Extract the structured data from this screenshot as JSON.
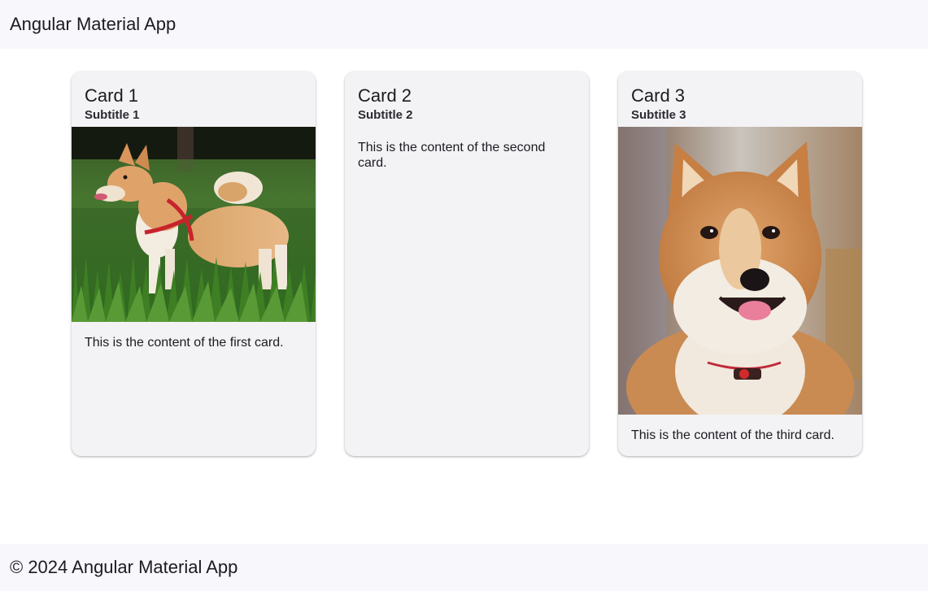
{
  "toolbar": {
    "title": "Angular Material App"
  },
  "cards": [
    {
      "title": "Card 1",
      "subtitle": "Subtitle 1",
      "content": "This is the content of the first card.",
      "image": "shiba-inu-standing-in-grass-photo"
    },
    {
      "title": "Card 2",
      "subtitle": "Subtitle 2",
      "content": "This is the content of the second card."
    },
    {
      "title": "Card 3",
      "subtitle": "Subtitle 3",
      "content": "This is the content of the third card.",
      "image": "shiba-inu-portrait-photo"
    }
  ],
  "footer": {
    "text": "© 2024 Angular Material App"
  },
  "colors": {
    "toolbar_bg": "#f8f7fb",
    "card_bg": "#f3f2f5",
    "text": "#1d1b20"
  }
}
